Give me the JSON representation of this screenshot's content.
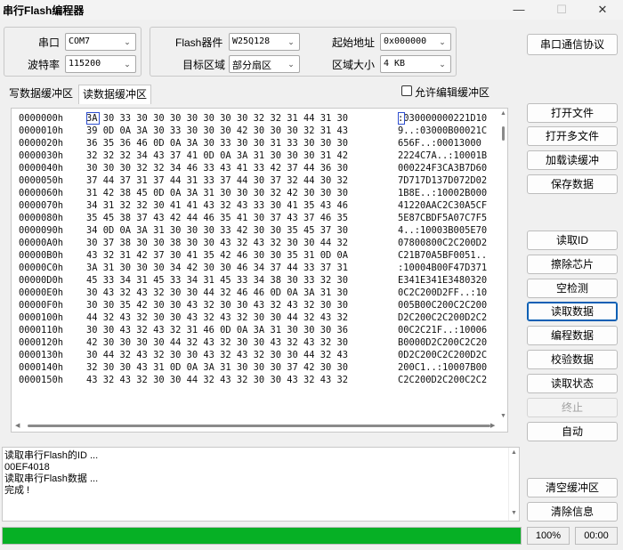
{
  "window": {
    "title": "串行Flash编程器",
    "minimize": "—",
    "maximize": "☐",
    "close": "✕"
  },
  "serial": {
    "port_label": "串口",
    "port_value": "COM7",
    "baud_label": "波特率",
    "baud_value": "115200"
  },
  "flash": {
    "device_label": "Flash器件",
    "device_value": "W25Q128",
    "region_label": "目标区域",
    "region_value": "部分扇区",
    "start_label": "起始地址",
    "start_value": "0x000000",
    "size_label": "区域大小",
    "size_value": "4 KB"
  },
  "buttons": {
    "protocol": "串口通信协议",
    "open_file": "打开文件",
    "open_multi": "打开多文件",
    "load_buffer": "加载读缓冲",
    "save_data": "保存数据",
    "read_id": "读取ID",
    "erase_chip": "擦除芯片",
    "blank_check": "空检测",
    "read_data": "读取数据",
    "program_data": "编程数据",
    "verify_data": "校验数据",
    "read_status": "读取状态",
    "stop": "终止",
    "auto": "自动",
    "clear_buffer": "清空缓冲区",
    "clear_info": "清除信息"
  },
  "tabs": {
    "write": "写数据缓冲区",
    "read": "读数据缓冲区",
    "allow_edit": "允许编辑缓冲区"
  },
  "hex": {
    "rows": [
      {
        "addr": "0000000h",
        "bytes": "3A 30 33 30 30 30 30 30 30 30 32 32 31 44 31 30",
        "ascii": ":030000000221D10"
      },
      {
        "addr": "0000010h",
        "bytes": "39 0D 0A 3A 30 33 30 30 30 42 30 30 30 32 31 43",
        "ascii": "9..:03000B00021C"
      },
      {
        "addr": "0000020h",
        "bytes": "36 35 36 46 0D 0A 3A 30 33 30 30 31 33 30 30 30",
        "ascii": "656F..:00013000"
      },
      {
        "addr": "0000030h",
        "bytes": "32 32 32 34 43 37 41 0D 0A 3A 31 30 30 30 31 42",
        "ascii": "2224C7A..:10001B"
      },
      {
        "addr": "0000040h",
        "bytes": "30 30 30 32 32 34 46 33 43 41 33 42 37 44 36 30",
        "ascii": "000224F3CA3B7D60"
      },
      {
        "addr": "0000050h",
        "bytes": "37 44 37 31 37 44 31 33 37 44 30 37 32 44 30 32",
        "ascii": "7D717D137D072D02"
      },
      {
        "addr": "0000060h",
        "bytes": "31 42 38 45 0D 0A 3A 31 30 30 30 32 42 30 30 30",
        "ascii": "1B8E..:10002B000"
      },
      {
        "addr": "0000070h",
        "bytes": "34 31 32 32 30 41 41 43 32 43 33 30 41 35 43 46",
        "ascii": "41220AAC2C30A5CF"
      },
      {
        "addr": "0000080h",
        "bytes": "35 45 38 37 43 42 44 46 35 41 30 37 43 37 46 35",
        "ascii": "5E87CBDF5A07C7F5"
      },
      {
        "addr": "0000090h",
        "bytes": "34 0D 0A 3A 31 30 30 30 33 42 30 30 35 45 37 30",
        "ascii": "4..:10003B005E70"
      },
      {
        "addr": "00000A0h",
        "bytes": "30 37 38 30 30 38 30 30 43 32 43 32 30 30 44 32",
        "ascii": "07800800C2C200D2"
      },
      {
        "addr": "00000B0h",
        "bytes": "43 32 31 42 37 30 41 35 42 46 30 30 35 31 0D 0A",
        "ascii": "C21B70A5BF0051.."
      },
      {
        "addr": "00000C0h",
        "bytes": "3A 31 30 30 30 34 42 30 30 46 34 37 44 33 37 31",
        "ascii": ":10004B00F47D371"
      },
      {
        "addr": "00000D0h",
        "bytes": "45 33 34 31 45 33 34 31 45 33 34 38 30 33 32 30",
        "ascii": "E341E341E3480320"
      },
      {
        "addr": "00000E0h",
        "bytes": "30 43 32 43 32 30 30 44 32 46 46 0D 0A 3A 31 30",
        "ascii": "0C2C200D2FF..:10"
      },
      {
        "addr": "00000F0h",
        "bytes": "30 30 35 42 30 30 43 32 30 30 43 32 43 32 30 30",
        "ascii": "005B00C200C2C200"
      },
      {
        "addr": "0000100h",
        "bytes": "44 32 43 32 30 30 43 32 43 32 30 30 44 32 43 32",
        "ascii": "D2C200C2C200D2C2"
      },
      {
        "addr": "0000110h",
        "bytes": "30 30 43 32 43 32 31 46 0D 0A 3A 31 30 30 30 36",
        "ascii": "00C2C21F..:10006"
      },
      {
        "addr": "0000120h",
        "bytes": "42 30 30 30 30 44 32 43 32 30 30 43 32 43 32 30",
        "ascii": "B0000D2C200C2C20"
      },
      {
        "addr": "0000130h",
        "bytes": "30 44 32 43 32 30 30 43 32 43 32 30 30 44 32 43",
        "ascii": "0D2C200C2C200D2C"
      },
      {
        "addr": "0000140h",
        "bytes": "32 30 30 43 31 0D 0A 3A 31 30 30 30 37 42 30 30",
        "ascii": "200C1..:10007B00"
      },
      {
        "addr": "0000150h",
        "bytes": "43 32 43 32 30 30 44 32 43 32 30 30 43 32 43 32",
        "ascii": "C2C200D2C200C2C2"
      }
    ]
  },
  "log": {
    "lines": [
      "读取串行Flash的ID ...",
      "00EF4018",
      "读取串行Flash数据 ...",
      "完成 !"
    ]
  },
  "status": {
    "progress_percent": 100,
    "percent_text": "100%",
    "time_text": "00:00"
  },
  "colors": {
    "progress": "#06b025",
    "focus": "#0a5fb4"
  },
  "icons": {
    "checkbox": "checkbox-icon",
    "dropdown": "chevron-down-icon"
  }
}
